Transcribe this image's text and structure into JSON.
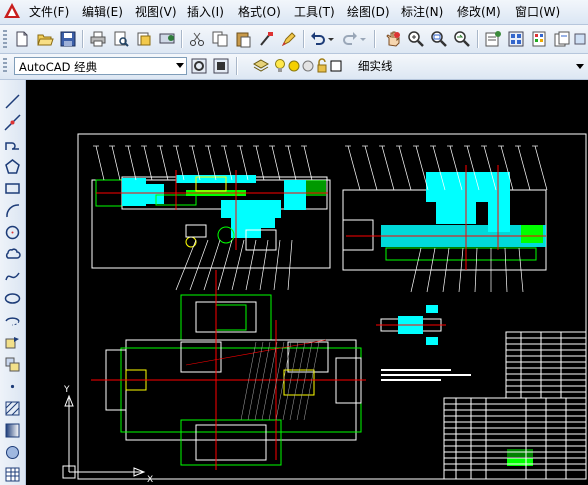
{
  "menu": {
    "items": [
      "文件(F)",
      "编辑(E)",
      "视图(V)",
      "插入(I)",
      "格式(O)",
      "工具(T)",
      "绘图(D)",
      "标注(N)",
      "修改(M)",
      "窗口(W)"
    ]
  },
  "toolbar": {
    "workspace": "AutoCAD 经典",
    "linetype": "细实线"
  },
  "colors": {
    "canvas_bg": "#000000",
    "accent_cyan": "#00ffff",
    "accent_green": "#00ff00",
    "accent_red": "#ff0000",
    "accent_yellow": "#ffff00"
  },
  "icons": {
    "standard_toolbar": [
      "new-icon",
      "open-icon",
      "save-icon",
      "print-icon",
      "print-preview-icon",
      "publish-icon",
      "plot-icon",
      "cut-icon",
      "copy-icon",
      "paste-icon",
      "match-properties-icon",
      "brush-icon",
      "undo-icon",
      "redo-icon",
      "pan-icon",
      "zoom-realtime-icon",
      "zoom-window-icon",
      "zoom-previous-icon",
      "properties-icon",
      "design-center-icon",
      "tool-palettes-icon",
      "sheet-set-icon"
    ],
    "draw_toolbar": [
      "line-icon",
      "construction-line-icon",
      "polyline-icon",
      "polygon-icon",
      "rectangle-icon",
      "arc-icon",
      "circle-icon",
      "revcloud-icon",
      "spline-icon",
      "ellipse-icon",
      "ellipse-arc-icon",
      "insert-block-icon",
      "make-block-icon",
      "point-icon",
      "hatch-icon",
      "gradient-icon",
      "region-icon",
      "table-icon"
    ]
  }
}
